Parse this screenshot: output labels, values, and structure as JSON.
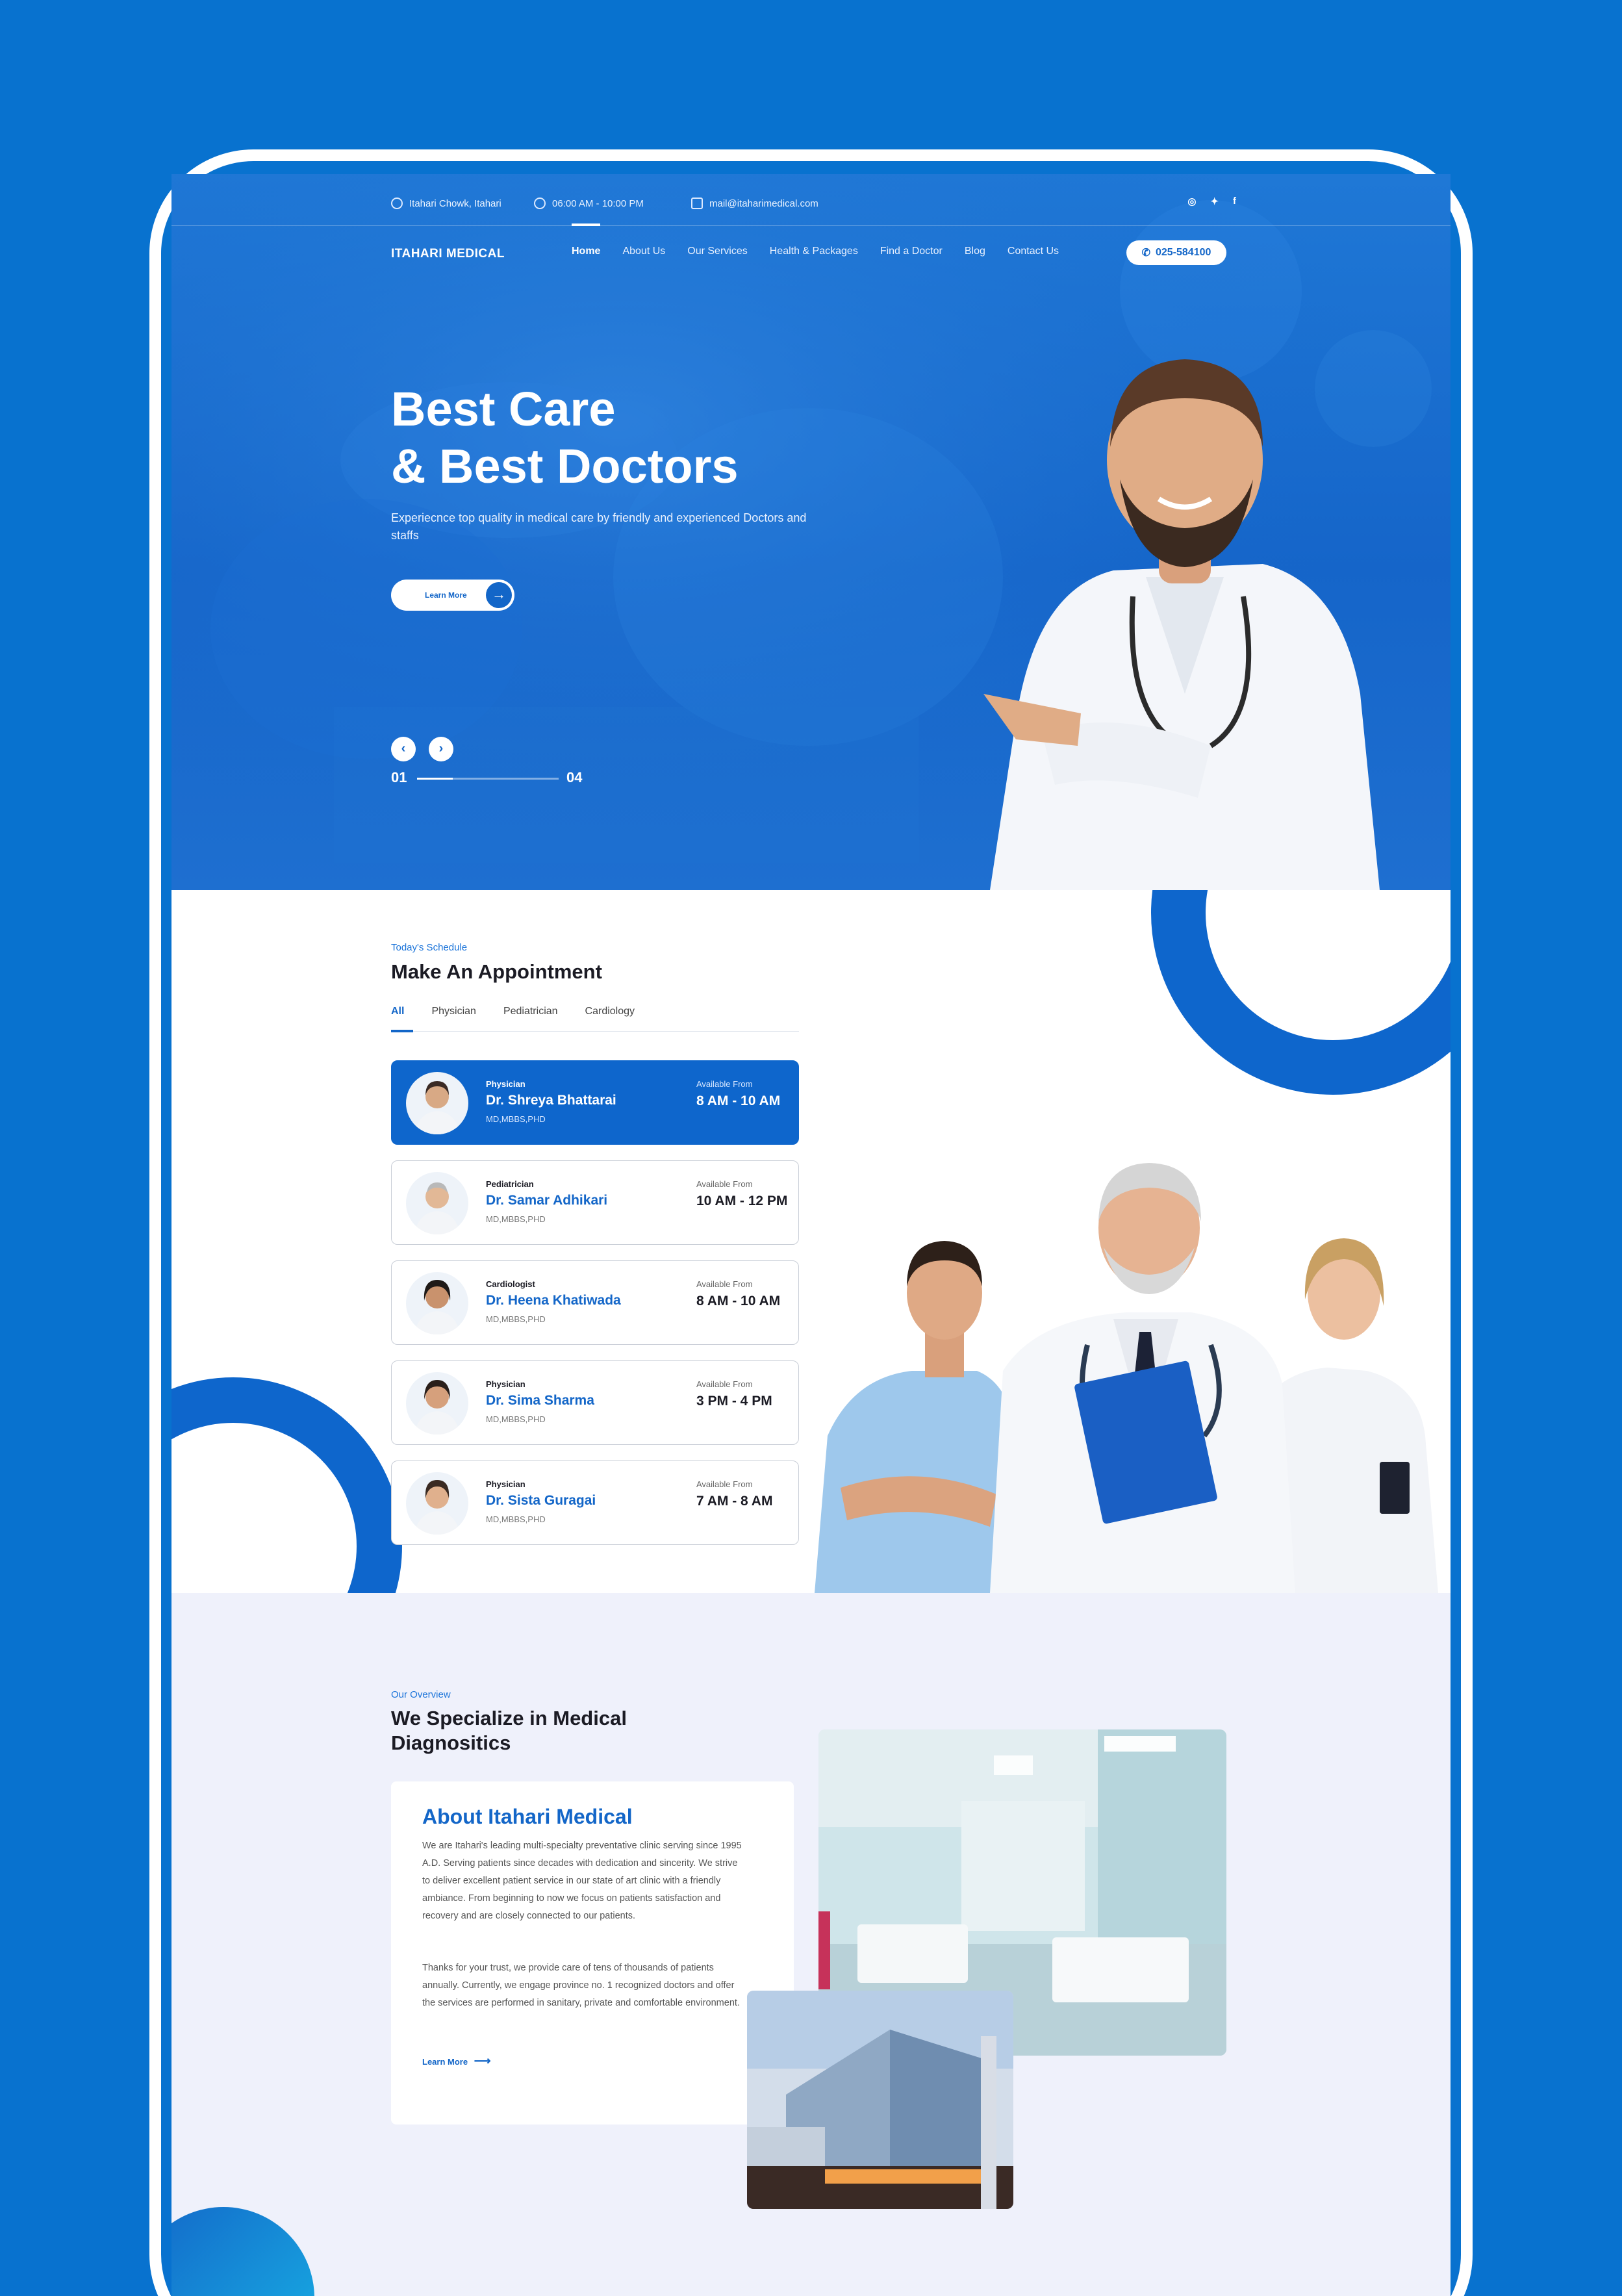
{
  "colors": {
    "brand_blue": "#0e66cc",
    "accent_light": "#eff1fb",
    "text_dark": "#1b1b24"
  },
  "topbar": {
    "address": "Itahari Chowk, Itahari",
    "hours": "06:00 AM - 10:00 PM",
    "email": "mail@itaharimedical.com",
    "socials": [
      "instagram-icon",
      "twitter-icon",
      "facebook-icon"
    ]
  },
  "nav": {
    "brand": "ITAHARI MEDICAL",
    "items": [
      {
        "label": "Home",
        "active": true
      },
      {
        "label": "About Us"
      },
      {
        "label": "Our Services"
      },
      {
        "label": "Health & Packages"
      },
      {
        "label": "Find a Doctor"
      },
      {
        "label": "Blog"
      },
      {
        "label": "Contact Us"
      }
    ],
    "phone": "025-584100"
  },
  "hero": {
    "title_line1": "Best Care",
    "title_line2": "& Best Doctors",
    "subtitle": "Experiecnce top quality in medical care by friendly and experienced Doctors and staffs",
    "cta": "Learn More",
    "slide_current": "01",
    "slide_total": "04",
    "slide_progress": 0.25
  },
  "appointment": {
    "eyebrow": "Today's Schedule",
    "title": "Make An Appointment",
    "tabs": [
      "All",
      "Physician",
      "Pediatrician",
      "Cardiology"
    ],
    "available_label": "Available From",
    "doctors": [
      {
        "specialty": "Physician",
        "name": "Dr. Shreya Bhattarai",
        "degree": "MD,MBBS,PHD",
        "time": "8 AM - 10 AM"
      },
      {
        "specialty": "Pediatrician",
        "name": "Dr. Samar Adhikari",
        "degree": "MD,MBBS,PHD",
        "time": "10 AM - 12 PM"
      },
      {
        "specialty": "Cardiologist",
        "name": "Dr. Heena Khatiwada",
        "degree": "MD,MBBS,PHD",
        "time": "8 AM - 10 AM"
      },
      {
        "specialty": "Physician",
        "name": "Dr. Sima Sharma",
        "degree": "MD,MBBS,PHD",
        "time": "3 PM - 4 PM"
      },
      {
        "specialty": "Physician",
        "name": "Dr. Sista Guragai",
        "degree": "MD,MBBS,PHD",
        "time": "7 AM - 8 AM"
      }
    ]
  },
  "overview": {
    "eyebrow": "Our Overview",
    "title_line1": "We Specialize in Medical",
    "title_line2": "Diagnositics",
    "about_title": "About Itahari Medical",
    "para1": "We are Itahari's leading multi-specialty preventative clinic serving since 1995 A.D. Serving patients since decades with dedication and sincerity. We strive to deliver excellent patient service in our state of art clinic with a friendly ambiance. From beginning to now we focus on patients satisfaction and recovery and are closely connected to our patients.",
    "para2": "Thanks for your trust, we provide care of tens of thousands of patients annually. Currently, we engage province no. 1 recognized doctors and offer the services are performed in sanitary, private and comfortable environment.",
    "link": "Learn More"
  }
}
